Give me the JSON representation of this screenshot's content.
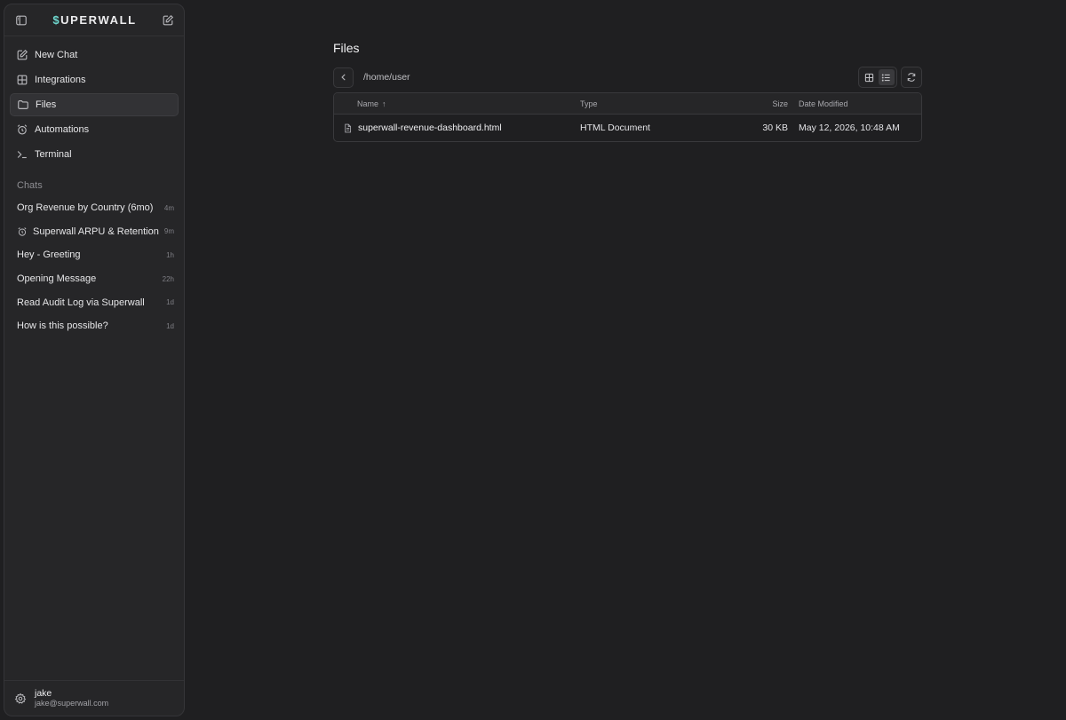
{
  "brand": {
    "prefix": "$",
    "name": "UPERWALL",
    "accent_color": "#6fd8cf"
  },
  "nav": [
    {
      "label": "New Chat",
      "icon": "edit-icon"
    },
    {
      "label": "Integrations",
      "icon": "grid-icon"
    },
    {
      "label": "Files",
      "icon": "folder-icon",
      "active": true
    },
    {
      "label": "Automations",
      "icon": "alarm-clock-icon"
    },
    {
      "label": "Terminal",
      "icon": "terminal-icon"
    }
  ],
  "chats": {
    "heading": "Chats",
    "items": [
      {
        "title": "Org Revenue by Country (6mo)",
        "time": "4m"
      },
      {
        "title": "Superwall ARPU & Retention",
        "time": "9m",
        "icon": "alarm-clock-icon"
      },
      {
        "title": "Hey - Greeting",
        "time": "1h"
      },
      {
        "title": "Opening Message",
        "time": "22h"
      },
      {
        "title": "Read Audit Log via Superwall",
        "time": "1d"
      },
      {
        "title": "How is this possible?",
        "time": "1d"
      }
    ]
  },
  "user": {
    "name": "jake",
    "email": "jake@superwall.com"
  },
  "main": {
    "title": "Files",
    "path": "/home/user",
    "view_mode": "list",
    "columns": {
      "name": "Name",
      "sort_indicator": "↑",
      "type": "Type",
      "size": "Size",
      "modified": "Date Modified"
    },
    "rows": [
      {
        "name": "superwall-revenue-dashboard.html",
        "type": "HTML Document",
        "size": "30 KB",
        "modified": "May 12, 2026, 10:48 AM"
      }
    ]
  }
}
